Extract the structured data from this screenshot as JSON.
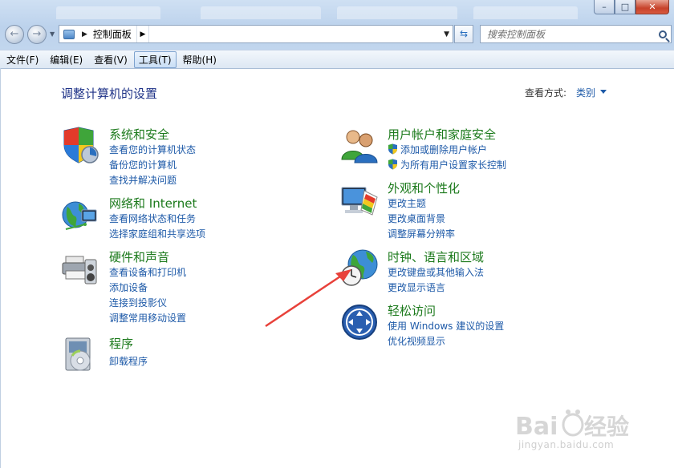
{
  "address_bar": {
    "crumb": "控制面板"
  },
  "search": {
    "placeholder": "搜索控制面板"
  },
  "menu": [
    {
      "label": "文件(F)"
    },
    {
      "label": "编辑(E)"
    },
    {
      "label": "查看(V)"
    },
    {
      "label": "工具(T)"
    },
    {
      "label": "帮助(H)"
    }
  ],
  "content": {
    "title": "调整计算机的设置",
    "view_by_label": "查看方式:",
    "view_by_value": "类别"
  },
  "categories": [
    {
      "title": "系统和安全",
      "icon": "system-security-icon",
      "links": [
        "查看您的计算机状态",
        "备份您的计算机",
        "查找并解决问题"
      ]
    },
    {
      "title": "网络和 Internet",
      "icon": "network-internet-icon",
      "links": [
        "查看网络状态和任务",
        "选择家庭组和共享选项"
      ]
    },
    {
      "title": "硬件和声音",
      "icon": "hardware-sound-icon",
      "links": [
        "查看设备和打印机",
        "添加设备",
        "连接到投影仪",
        "调整常用移动设置"
      ]
    },
    {
      "title": "程序",
      "icon": "programs-icon",
      "links": [
        "卸载程序"
      ]
    },
    {
      "title": "用户帐户和家庭安全",
      "icon": "user-accounts-icon",
      "links": [
        "添加或删除用户帐户",
        "为所有用户设置家长控制"
      ]
    },
    {
      "title": "外观和个性化",
      "icon": "appearance-icon",
      "links": [
        "更改主题",
        "更改桌面背景",
        "调整屏幕分辨率"
      ]
    },
    {
      "title": "时钟、语言和区域",
      "icon": "clock-language-region-icon",
      "links": [
        "更改键盘或其他输入法",
        "更改显示语言"
      ]
    },
    {
      "title": "轻松访问",
      "icon": "ease-of-access-icon",
      "links": [
        "使用 Windows 建议的设置",
        "优化视频显示"
      ]
    }
  ],
  "watermark": {
    "logo": "Baidu经验",
    "url": "jingyan.baidu.com"
  },
  "colors": {
    "title_blue": "#1e3287",
    "category_green": "#1c7a1c",
    "link_blue": "#1e5aa8",
    "annotation_red": "#e8413a"
  }
}
